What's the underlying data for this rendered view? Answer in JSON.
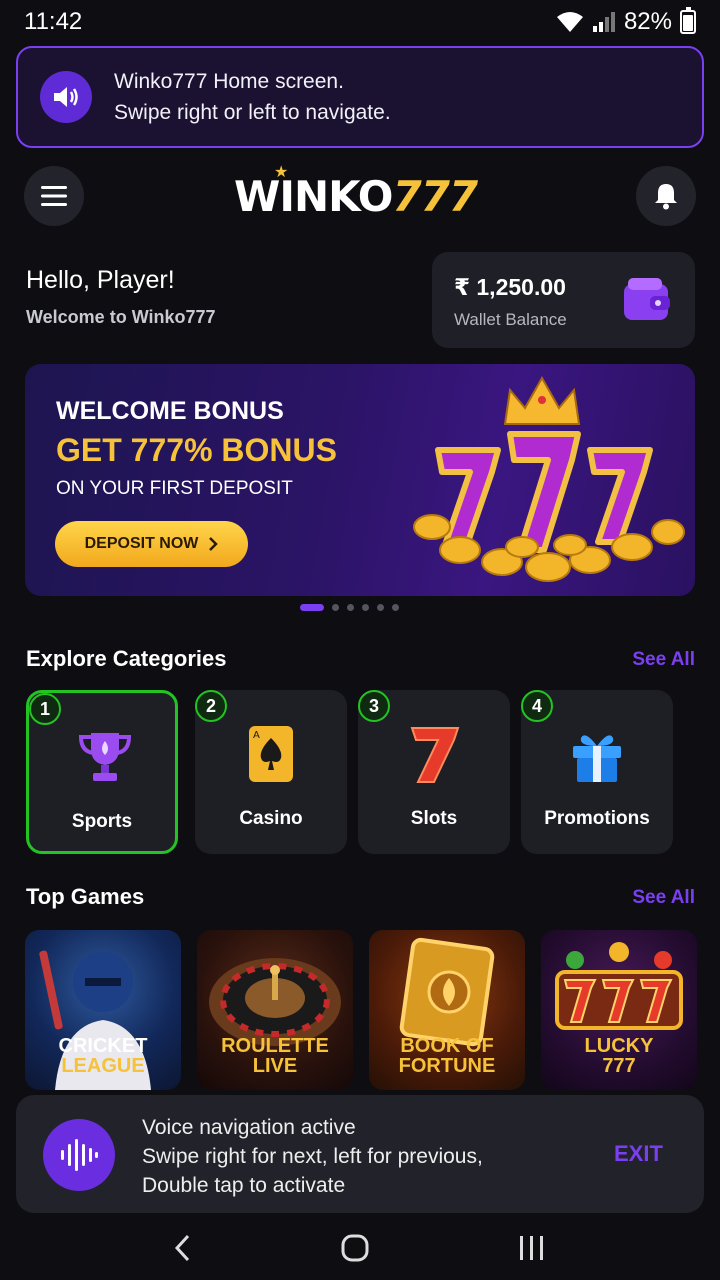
{
  "status_bar": {
    "time": "11:42",
    "battery": "82%"
  },
  "talkback": {
    "line1": "Winko777 Home screen.",
    "line2": "Swipe right or left to navigate."
  },
  "header": {
    "logo_main": "WINKO",
    "logo_num": "777",
    "menu_icon": "hamburger-icon",
    "bell_icon": "bell-icon"
  },
  "greeting": {
    "title": "Hello, Player!",
    "subtitle": "Welcome to Winko777"
  },
  "wallet": {
    "amount": "₹ 1,250.00",
    "label": "Wallet Balance",
    "icon": "wallet-icon"
  },
  "promo": {
    "line1": "WELCOME BONUS",
    "line2": "GET 777% BONUS",
    "line3": "ON YOUR FIRST DEPOSIT",
    "button": "DEPOSIT NOW"
  },
  "carousel": {
    "total": 6,
    "active": 1
  },
  "categories": {
    "title": "Explore Categories",
    "see_all": "See All",
    "items": [
      {
        "num": "1",
        "label": "Sports",
        "icon": "trophy-icon"
      },
      {
        "num": "2",
        "label": "Casino",
        "icon": "spade-card-icon"
      },
      {
        "num": "3",
        "label": "Slots",
        "icon": "seven-icon"
      },
      {
        "num": "4",
        "label": "Promotions",
        "icon": "gift-icon"
      }
    ]
  },
  "top_games": {
    "title": "Top Games",
    "see_all": "See All",
    "items": [
      {
        "t1": "CRICKET",
        "t2": "LEAGUE"
      },
      {
        "t1": "ROULETTE",
        "t2": "LIVE"
      },
      {
        "t1": "BOOK OF",
        "t2": "FORTUNE"
      },
      {
        "t1": "LUCKY",
        "t2": "777"
      }
    ]
  },
  "voice_nav": {
    "line1": "Voice navigation active",
    "line2": "Swipe right for next, left for previous,",
    "line3": "Double tap to activate",
    "exit": "EXIT"
  },
  "colors": {
    "accent": "#7b3ff2",
    "gold": "#f6c23a",
    "focus": "#22c322"
  }
}
